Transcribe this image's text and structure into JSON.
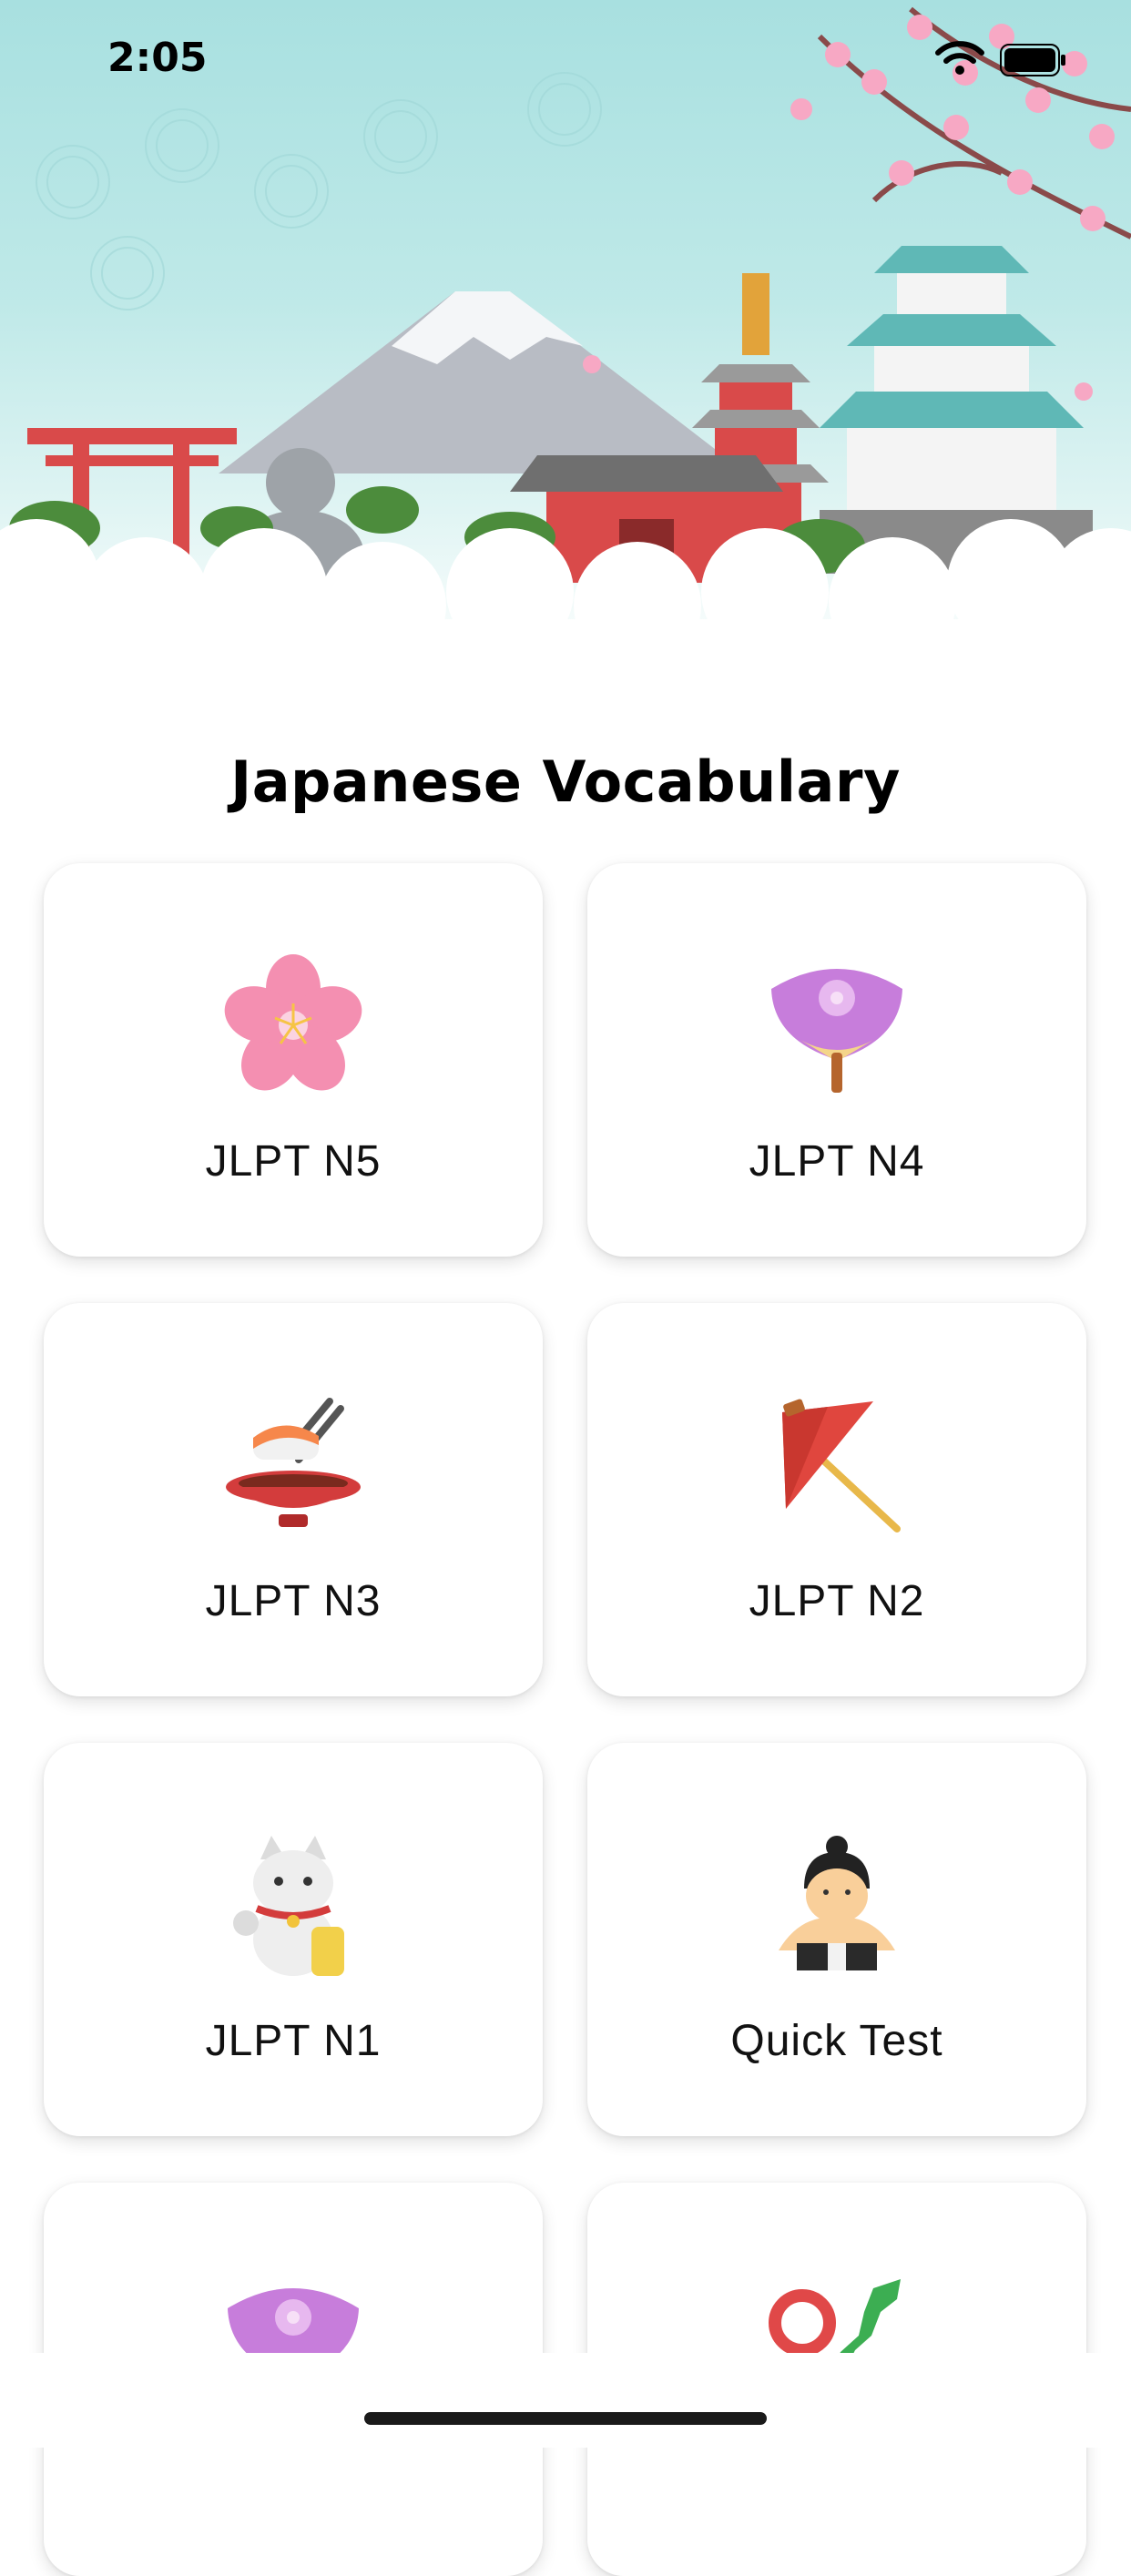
{
  "status_bar": {
    "time": "2:05"
  },
  "page": {
    "title": "Japanese Vocabulary"
  },
  "cards": [
    {
      "label": "JLPT N5",
      "icon": "sakura-flower-icon"
    },
    {
      "label": "JLPT N4",
      "icon": "paper-fan-icon"
    },
    {
      "label": "JLPT N3",
      "icon": "sushi-bowl-icon"
    },
    {
      "label": "JLPT N2",
      "icon": "wagasa-umbrella-icon"
    },
    {
      "label": "JLPT N1",
      "icon": "lucky-cat-icon"
    },
    {
      "label": "Quick Test",
      "icon": "sumo-wrestler-icon"
    },
    {
      "label": "",
      "icon": "paper-fan-icon"
    },
    {
      "label": "",
      "icon": "japan-flag-map-icon"
    }
  ],
  "colors": {
    "sky": "#a8e0e0",
    "sakura_pink": "#f48fb1",
    "torii_red": "#e04848",
    "fan_purple": "#c77ddb"
  }
}
